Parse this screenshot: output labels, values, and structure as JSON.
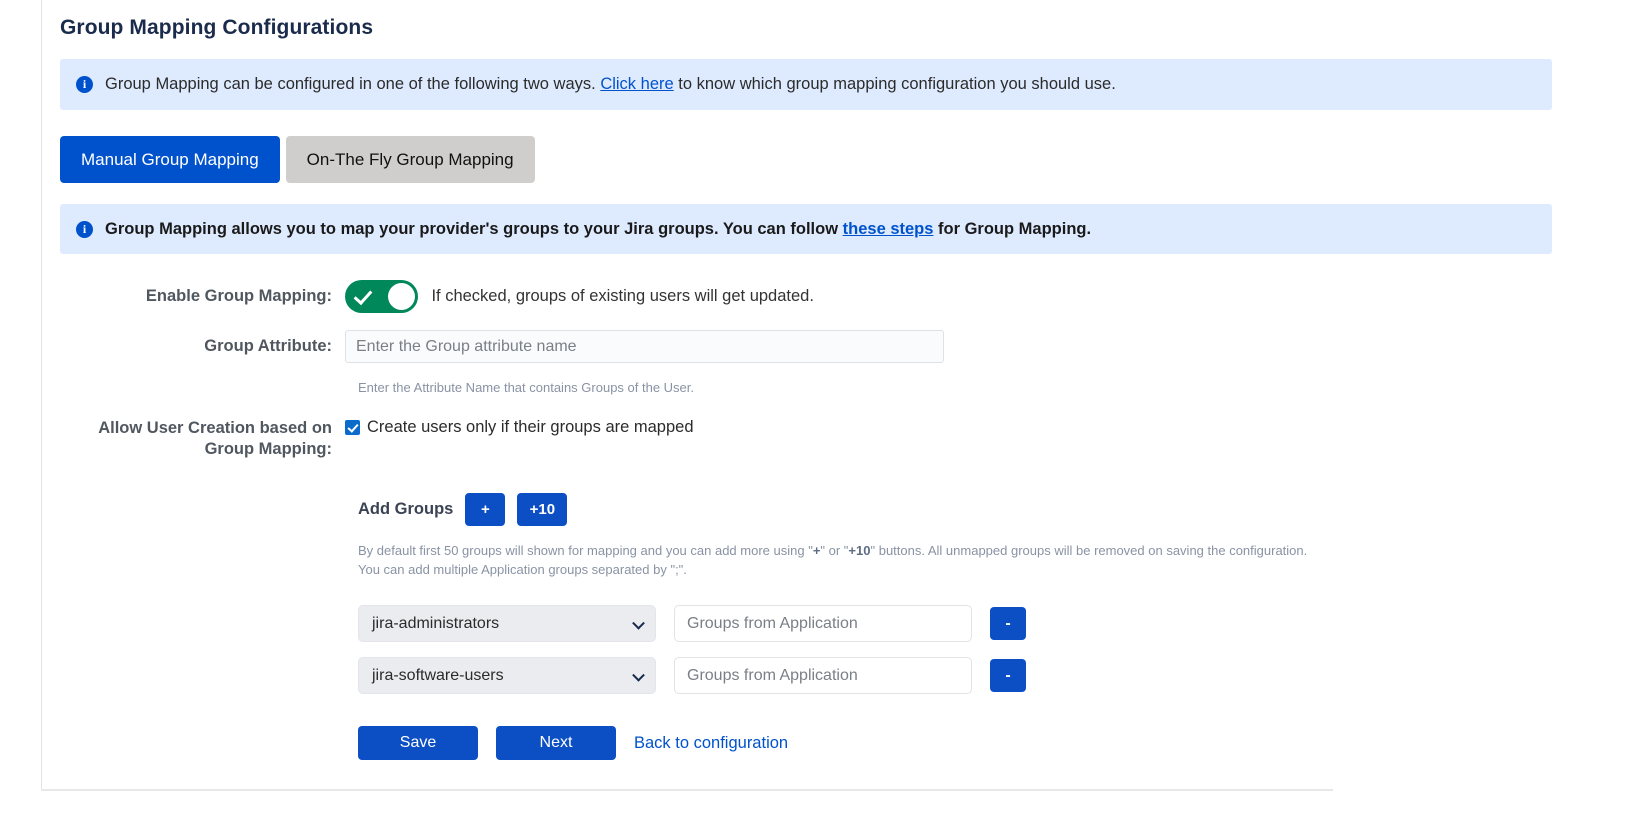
{
  "page": {
    "title": "Group Mapping Configurations"
  },
  "banner_top": {
    "icon": "info-icon",
    "text_before": "Group Mapping can be configured in one of the following two ways. ",
    "link": "Click here",
    "text_after": " to know which group mapping configuration you should use."
  },
  "tabs": [
    {
      "label": "Manual Group Mapping",
      "active": true
    },
    {
      "label": "On-The Fly Group Mapping",
      "active": false
    }
  ],
  "banner_mapping": {
    "icon": "info-icon",
    "text_before": "Group Mapping allows you to map your provider's groups to your Jira groups. You can follow ",
    "link": "these steps",
    "text_after": " for Group Mapping."
  },
  "form": {
    "enable_group_mapping": {
      "label": "Enable Group Mapping:",
      "toggle_state": "on",
      "hint": "If checked, groups of existing users will get updated."
    },
    "group_attribute": {
      "label": "Group Attribute:",
      "value": "",
      "placeholder": "Enter the Group attribute name",
      "help": "Enter the Attribute Name that contains Groups of the User."
    },
    "allow_user_creation": {
      "label": "Allow User Creation based on Group Mapping:",
      "checkbox_checked": true,
      "checkbox_label": "Create users only if their groups are mapped"
    },
    "add_groups": {
      "label": "Add Groups",
      "plus_label": "+",
      "plus_ten_label": "+10",
      "help_line1_a": "By default first 50 groups will shown for mapping and you can add more using \"",
      "help_line1_b": "+",
      "help_line1_c": "\" or \"",
      "help_line1_d": "+10",
      "help_line1_e": "\" buttons. All unmapped groups will be removed on saving the configuration.",
      "help_line2": "You can add multiple Application groups separated by \";\"."
    },
    "mapping_rows": [
      {
        "group": "jira-administrators",
        "app_groups_value": "",
        "app_groups_placeholder": "Groups from Application",
        "remove_label": "-"
      },
      {
        "group": "jira-software-users",
        "app_groups_value": "",
        "app_groups_placeholder": "Groups from Application",
        "remove_label": "-"
      }
    ]
  },
  "actions": {
    "save_label": "Save",
    "next_label": "Next",
    "back_label": "Back to configuration"
  },
  "colors": {
    "accent_blue": "#0052cc",
    "button_blue": "#0c4fc4",
    "toggle_green": "#00875a",
    "banner_bg": "#deebff",
    "tab_inactive": "#d0cecd"
  }
}
